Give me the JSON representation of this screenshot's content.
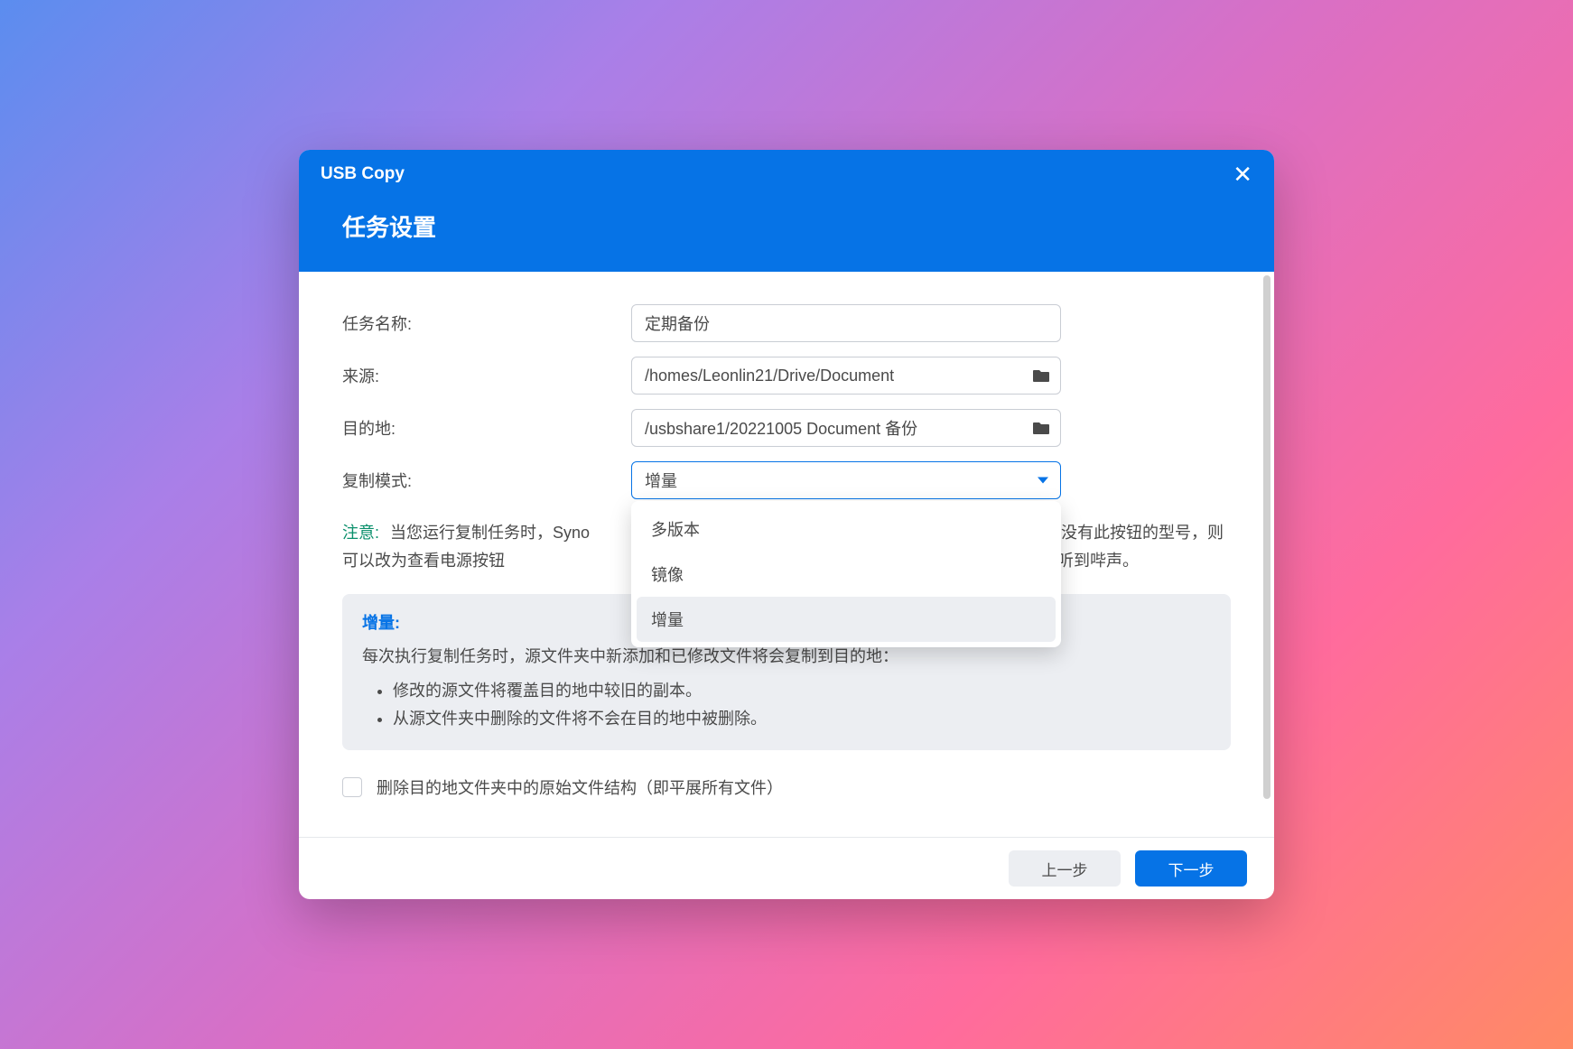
{
  "titlebar": {
    "title": "USB Copy"
  },
  "header": {
    "title": "任务设置"
  },
  "form": {
    "task_label": "任务名称:",
    "task_value": "定期备份",
    "source_label": "来源:",
    "source_value": "/homes/Leonlin21/Drive/Document",
    "dest_label": "目的地:",
    "dest_value": "/usbshare1/20221005 Document 备份",
    "mode_label": "复制模式:",
    "mode_value": "增量",
    "mode_options": [
      "多版本",
      "镜像",
      "增量"
    ]
  },
  "note": {
    "label": "注意:",
    "text_prefix": "当您运行复制任务时，Syno",
    "text_suffix": "束（对于没有此按钮的型号，则可以改为查看电源按钮",
    "text_tail": "哔声设置，则在任务开始和结束时还会听到哔声。"
  },
  "info": {
    "title": "增量:",
    "lead": "每次执行复制任务时，源文件夹中新添加和已修改文件将会复制到目的地：",
    "bullets": [
      "修改的源文件将覆盖目的地中较旧的副本。",
      "从源文件夹中删除的文件将不会在目的地中被删除。"
    ]
  },
  "checkbox": {
    "label": "删除目的地文件夹中的原始文件结构（即平展所有文件）"
  },
  "footer": {
    "prev": "上一步",
    "next": "下一步"
  }
}
